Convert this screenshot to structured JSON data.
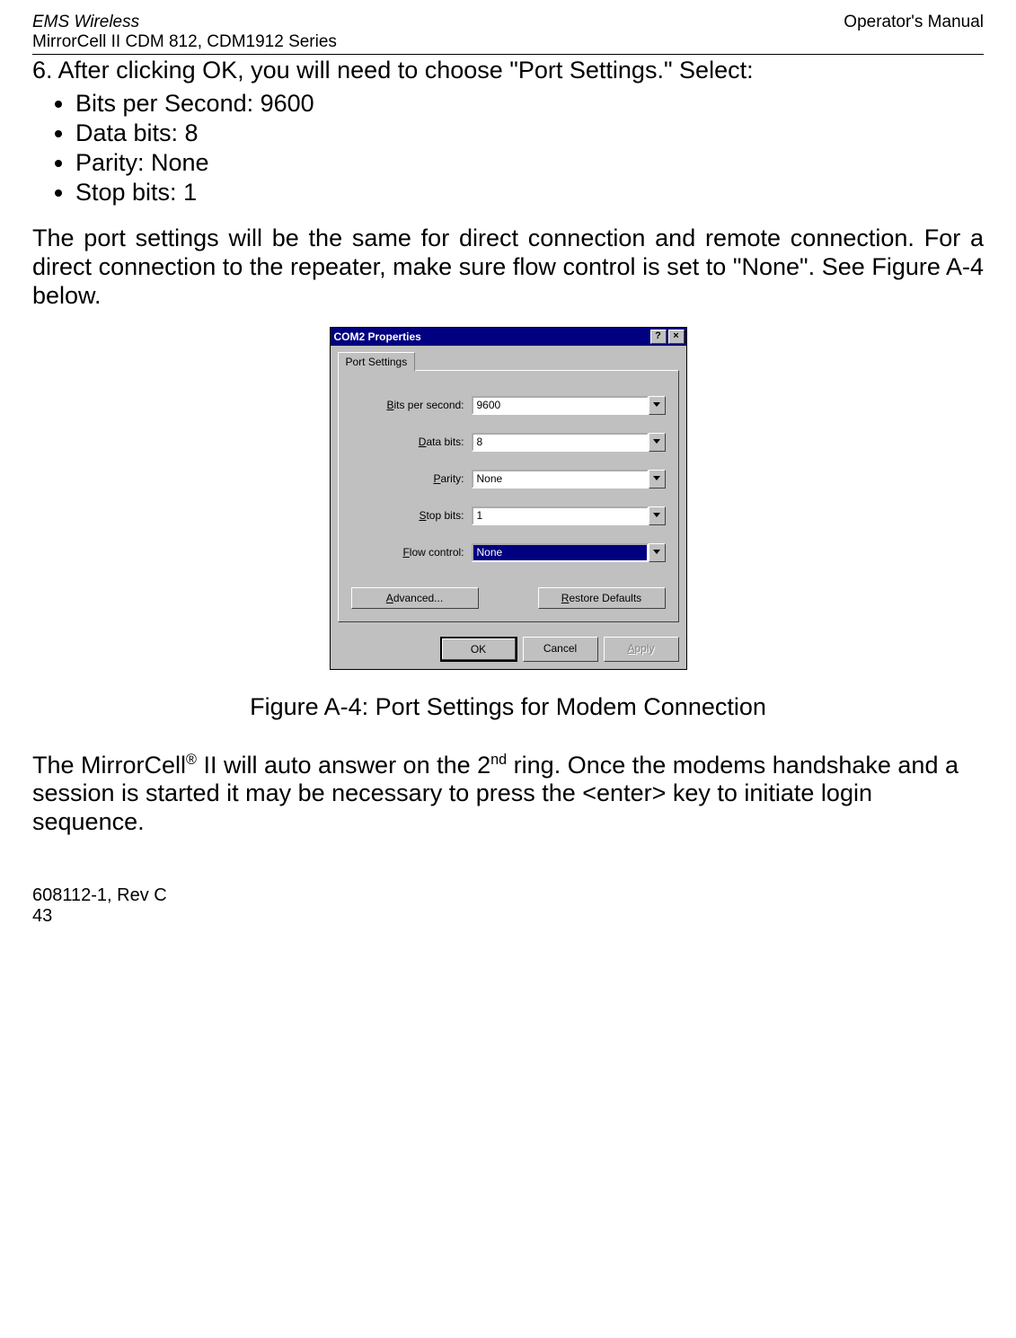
{
  "header": {
    "left_line1_a": "EMS ",
    "left_line1_b": "Wireless",
    "left_line2": "MirrorCell II CDM 812, CDM1912 Series",
    "right": "Operator's Manual"
  },
  "step6_num": "6.",
  "step6_text": "After clicking OK, you will need to choose \"Port Settings.\" Select:",
  "bullets": [
    "Bits per Second: 9600",
    "Data bits: 8",
    "Parity: None",
    "Stop bits: 1"
  ],
  "para1": "The port settings will be the same for direct connection and remote connection. For a direct connection to the repeater, make sure flow control is set to \"None\".   See Figure A-4 below.",
  "dialog": {
    "title": "COM2 Properties",
    "help_btn": "?",
    "close_btn": "×",
    "tab_label": "Port Settings",
    "fields": {
      "bps": {
        "label_pre": "",
        "label_u": "B",
        "label_post": "its per second:",
        "value": "9600"
      },
      "data": {
        "label_pre": "",
        "label_u": "D",
        "label_post": "ata bits:",
        "value": "8"
      },
      "parity": {
        "label_pre": "",
        "label_u": "P",
        "label_post": "arity:",
        "value": "None"
      },
      "stop": {
        "label_pre": "",
        "label_u": "S",
        "label_post": "top bits:",
        "value": "1"
      },
      "flow": {
        "label_pre": "",
        "label_u": "F",
        "label_post": "low control:",
        "value": "None"
      }
    },
    "buttons": {
      "advanced_u": "A",
      "advanced_rest": "dvanced...",
      "restore_u": "R",
      "restore_rest": "estore Defaults",
      "ok": "OK",
      "cancel": "Cancel",
      "apply_u": "A",
      "apply_rest": "pply"
    }
  },
  "figure_caption": "Figure A-4:  Port Settings for Modem Connection",
  "para2_pre": "The MirrorCell",
  "para2_reg": "®",
  "para2_mid1": " II  will auto answer on the 2",
  "para2_sup": "nd",
  "para2_mid2": " ring. Once the modems handshake and a session is started it may be necessary to press the <enter> key to initiate login sequence.",
  "footer_line1": "608112-1, Rev C",
  "footer_line2": "43"
}
